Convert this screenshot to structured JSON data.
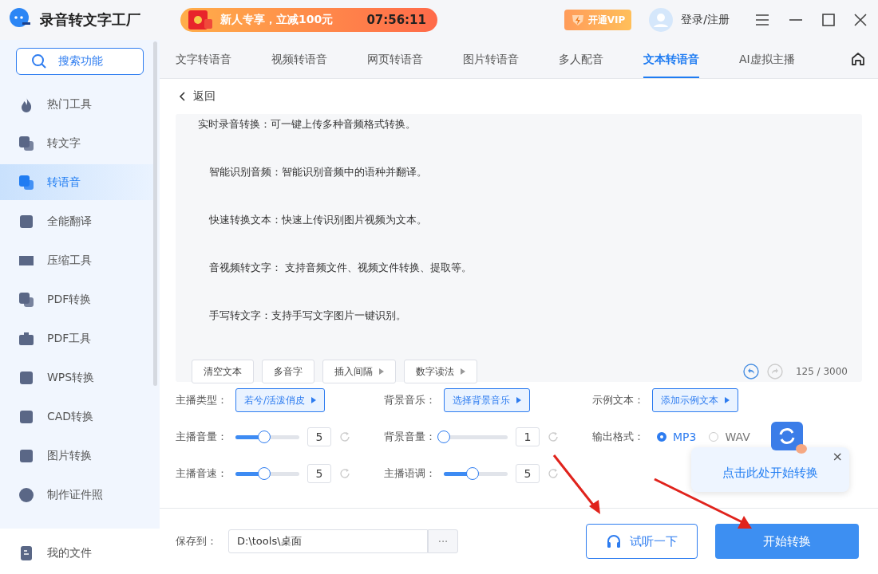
{
  "app": {
    "title": "录音转文字工厂"
  },
  "promo": {
    "text": "新人专享，立减100元",
    "countdown": "07:56:11"
  },
  "vip_button": "开通VIP",
  "login": "登录/注册",
  "sidebar": {
    "search": "搜索功能",
    "items": [
      {
        "label": "热门工具",
        "selected": false
      },
      {
        "label": "转文字",
        "selected": false
      },
      {
        "label": "转语音",
        "selected": true
      },
      {
        "label": "全能翻译",
        "selected": false
      },
      {
        "label": "压缩工具",
        "selected": false
      },
      {
        "label": "PDF转换",
        "selected": false
      },
      {
        "label": "PDF工具",
        "selected": false
      },
      {
        "label": "WPS转换",
        "selected": false
      },
      {
        "label": "CAD转换",
        "selected": false
      },
      {
        "label": "图片转换",
        "selected": false
      },
      {
        "label": "制作证件照",
        "selected": false
      }
    ],
    "footer": "我的文件"
  },
  "tabs": [
    {
      "label": "文字转语音",
      "selected": false
    },
    {
      "label": "视频转语音",
      "selected": false
    },
    {
      "label": "网页转语音",
      "selected": false
    },
    {
      "label": "图片转语音",
      "selected": false
    },
    {
      "label": "多人配音",
      "selected": false
    },
    {
      "label": "文本转语音",
      "selected": true
    },
    {
      "label": "AI虚拟主播",
      "selected": false
    }
  ],
  "back": "返回",
  "editor": {
    "paragraphs": [
      "实时录音转换：可一键上传多种音频格式转换。",
      "智能识别音频：智能识别音频中的语种并翻译。",
      "快速转换文本：快速上传识别图片视频为文本。",
      "音视频转文字： 支持音频文件、视频文件转换、提取等。",
      "手写转文字：支持手写文字图片一键识别。"
    ],
    "tools": [
      {
        "label": "清空文本",
        "dropdown": false
      },
      {
        "label": "多音字",
        "dropdown": false
      },
      {
        "label": "插入间隔",
        "dropdown": true
      },
      {
        "label": "数字读法",
        "dropdown": true
      }
    ],
    "undo_enabled": true,
    "redo_enabled": false,
    "count": "125 / 3000"
  },
  "options": {
    "selects": [
      {
        "label": "主播类型：",
        "value": "若兮/活泼俏皮"
      },
      {
        "label": "背景音乐：",
        "value": "选择背景音乐"
      },
      {
        "label": "示例文本：",
        "value": "添加示例文本"
      }
    ],
    "sliders": [
      {
        "label": "主播音量：",
        "level": 0.45,
        "value": "5"
      },
      {
        "label": "背景音量：",
        "level": 0.0,
        "value": "1"
      },
      {
        "label": "主播音速：",
        "level": 0.45,
        "value": "5"
      },
      {
        "label": "主播语调：",
        "level": 0.45,
        "value": "5"
      }
    ],
    "format": {
      "label": "输出格式：",
      "choices": [
        {
          "label": "MP3",
          "selected": true
        },
        {
          "label": "WAV",
          "selected": false
        }
      ]
    }
  },
  "save": {
    "label": "保存到：",
    "path": "D:\\tools\\桌面",
    "browse": "···"
  },
  "preview_button": "试听一下",
  "start_button": "开始转换",
  "tooltip": {
    "text": "点击此处开始转换",
    "close": "×"
  }
}
